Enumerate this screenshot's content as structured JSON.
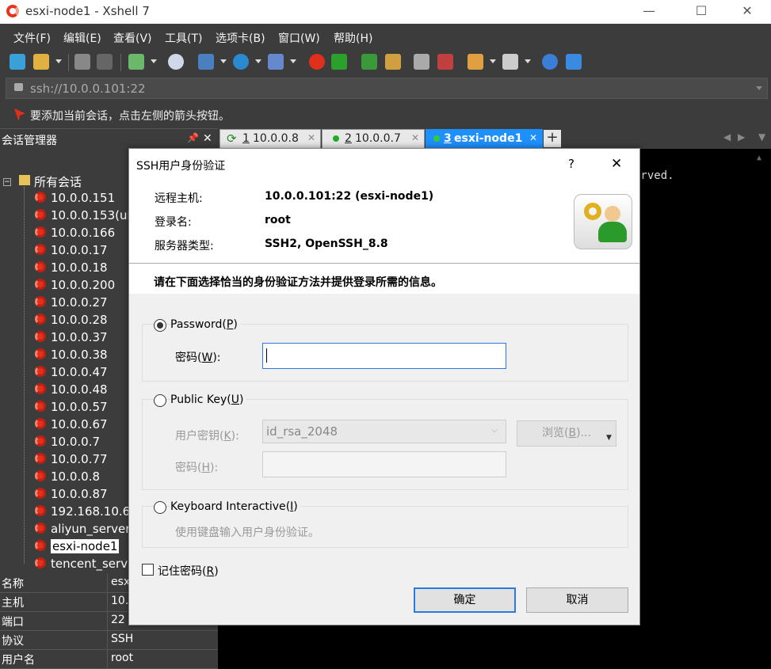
{
  "window": {
    "title": "esxi-node1 - Xshell 7",
    "minimize": "—",
    "maximize": "☐",
    "close": "✕"
  },
  "menu": [
    "文件(F)",
    "编辑(E)",
    "查看(V)",
    "工具(T)",
    "选项卡(B)",
    "窗口(W)",
    "帮助(H)"
  ],
  "address": {
    "value": "ssh://10.0.0.101:22"
  },
  "hint": "要添加当前会话，点击左侧的箭头按钮。",
  "session_manager": {
    "title": "会话管理器",
    "pin": "📌",
    "close": "✕",
    "root": "所有会话",
    "items": [
      "10.0.0.151",
      "10.0.0.153(ub",
      "10.0.0.166",
      "10.0.0.17",
      "10.0.0.18",
      "10.0.0.200",
      "10.0.0.27",
      "10.0.0.28",
      "10.0.0.37",
      "10.0.0.38",
      "10.0.0.47",
      "10.0.0.48",
      "10.0.0.57",
      "10.0.0.67",
      "10.0.0.7",
      "10.0.0.77",
      "10.0.0.8",
      "10.0.0.87",
      "192.168.10.6",
      "aliyun_server",
      "esxi-node1",
      "tencent_serve"
    ],
    "selected": "esxi-node1"
  },
  "properties": [
    [
      "名称",
      "esx"
    ],
    [
      "主机",
      "10."
    ],
    [
      "端口",
      "22"
    ],
    [
      "协议",
      "SSH"
    ],
    [
      "用户名",
      "root"
    ]
  ],
  "tabs": [
    {
      "num": "1",
      "label": "10.0.0.8"
    },
    {
      "num": "2",
      "label": "10.0.0.7"
    },
    {
      "num": "3",
      "label": "esxi-node1"
    }
  ],
  "terminal_text": "erved.",
  "dialog": {
    "title": "SSH用户身份验证",
    "help": "?",
    "close": "✕",
    "remote_host_label": "远程主机:",
    "remote_host": "10.0.0.101:22 (esxi-node1)",
    "login_label": "登录名:",
    "login": "root",
    "server_type_label": "服务器类型:",
    "server_type": "SSH2, OpenSSH_8.8",
    "instruction": "请在下面选择恰当的身份验证方法并提供登录所需的信息。",
    "password_option": "Password",
    "password_key": "P",
    "password_label": "密码",
    "password_label_key": "W",
    "pubkey_option": "Public Key",
    "pubkey_key": "U",
    "user_key_label": "用户密钥",
    "user_key_key": "K",
    "user_key_value": "id_rsa_2048",
    "browse": "浏览",
    "browse_key": "B",
    "passphrase_label": "密码",
    "passphrase_key": "H",
    "kbd_option": "Keyboard Interactive",
    "kbd_key": "I",
    "kbd_desc": "使用键盘输入用户身份验证。",
    "remember": "记住密码",
    "remember_key": "R",
    "ok": "确定",
    "cancel": "取消"
  }
}
